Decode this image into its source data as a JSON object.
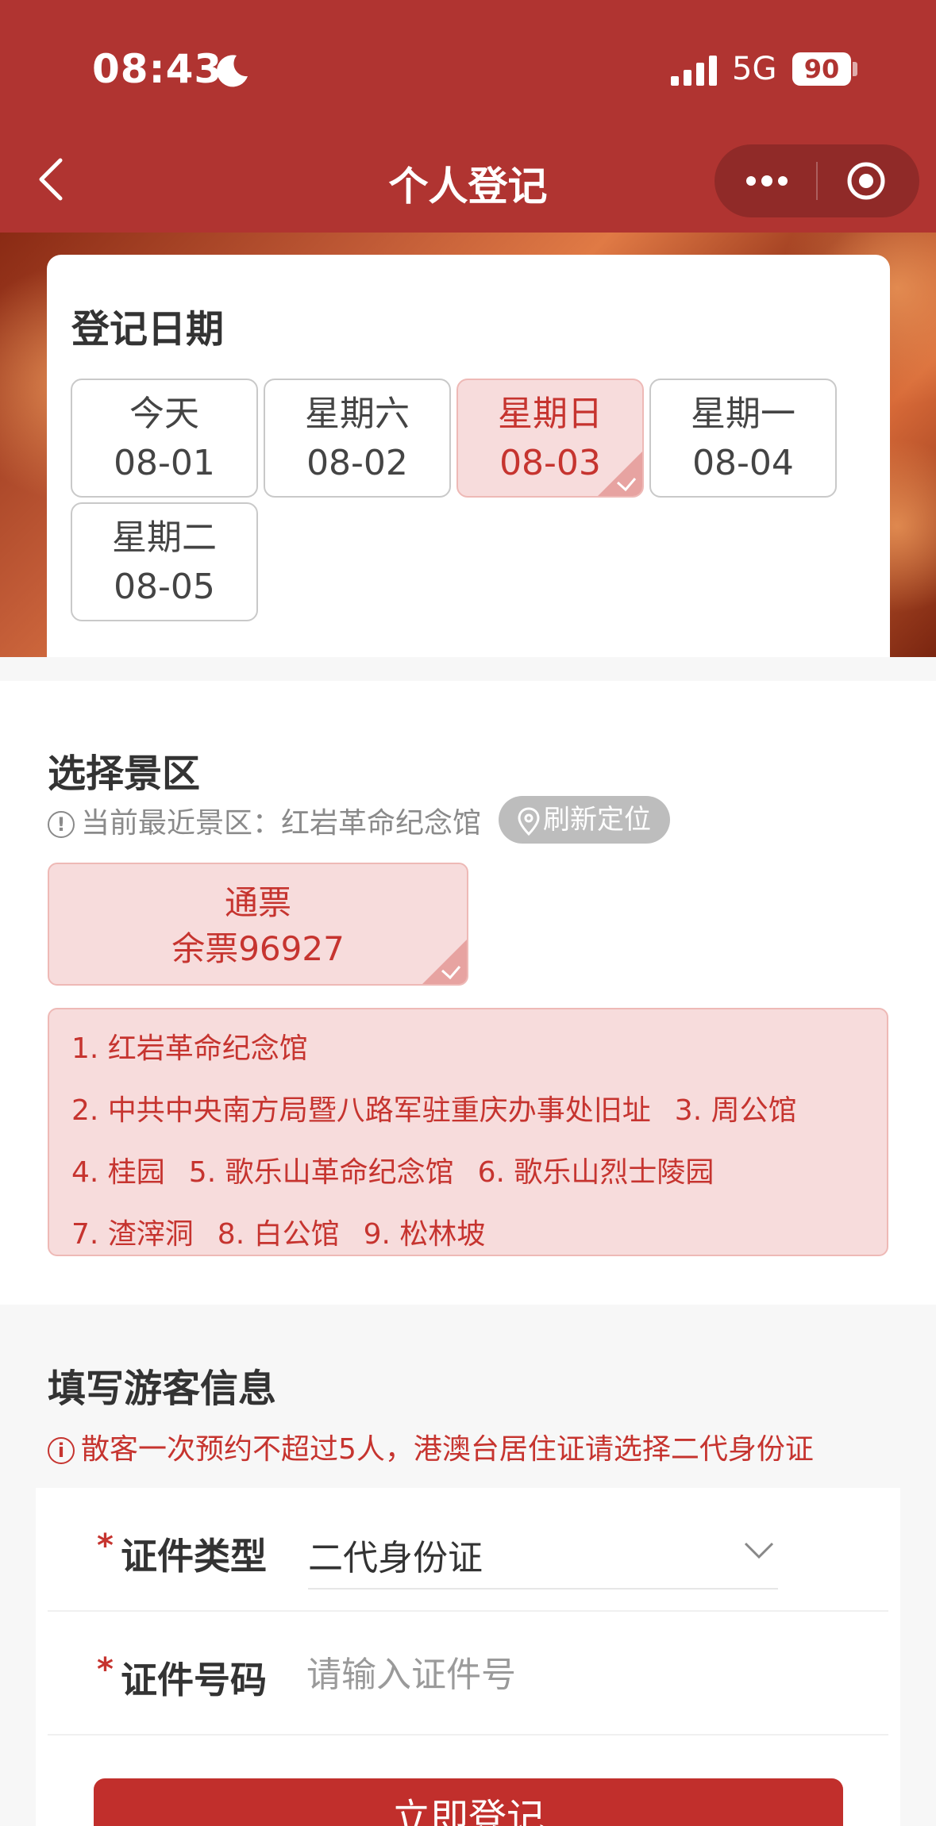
{
  "status_bar": {
    "time": "08:43",
    "network": "5G",
    "battery": "90"
  },
  "nav": {
    "title": "个人登记"
  },
  "date_section": {
    "title": "登记日期",
    "dates": [
      {
        "day": "今天",
        "date": "08-01"
      },
      {
        "day": "星期六",
        "date": "08-02"
      },
      {
        "day": "星期日",
        "date": "08-03",
        "selected": true
      },
      {
        "day": "星期一",
        "date": "08-04"
      },
      {
        "day": "星期二",
        "date": "08-05"
      }
    ]
  },
  "scenic_section": {
    "title": "选择景区",
    "nearest_hint": "当前最近景区：红岩革命纪念馆",
    "refresh_label": "刷新定位",
    "ticket": {
      "name": "通票",
      "remaining": "余票96927"
    },
    "spots": [
      "1. 红岩革命纪念馆",
      "2. 中共中央南方局暨八路军驻重庆办事处旧址",
      "3. 周公馆",
      "4. 桂园",
      "5. 歌乐山革命纪念馆",
      "6. 歌乐山烈士陵园",
      "7. 渣滓洞",
      "8. 白公馆",
      "9. 松林坡"
    ]
  },
  "visitor_section": {
    "title": "填写游客信息",
    "warning": "散客一次预约不超过5人，港澳台居住证请选择二代身份证",
    "id_type_label": "证件类型",
    "id_type_value": "二代身份证",
    "id_number_label": "证件号码",
    "id_number_placeholder": "请输入证件号",
    "required_mark": "*"
  },
  "submit_label": "立即登记",
  "colors": {
    "brand": "#b03431",
    "accent": "#c6342f",
    "selected_bg": "#f7dcdc"
  },
  "icons": [
    "moon-icon",
    "signal-icon",
    "back-chevron-icon",
    "more-dots-icon",
    "target-icon",
    "info-icon",
    "location-pin-icon",
    "check-icon",
    "chevron-down-icon"
  ]
}
